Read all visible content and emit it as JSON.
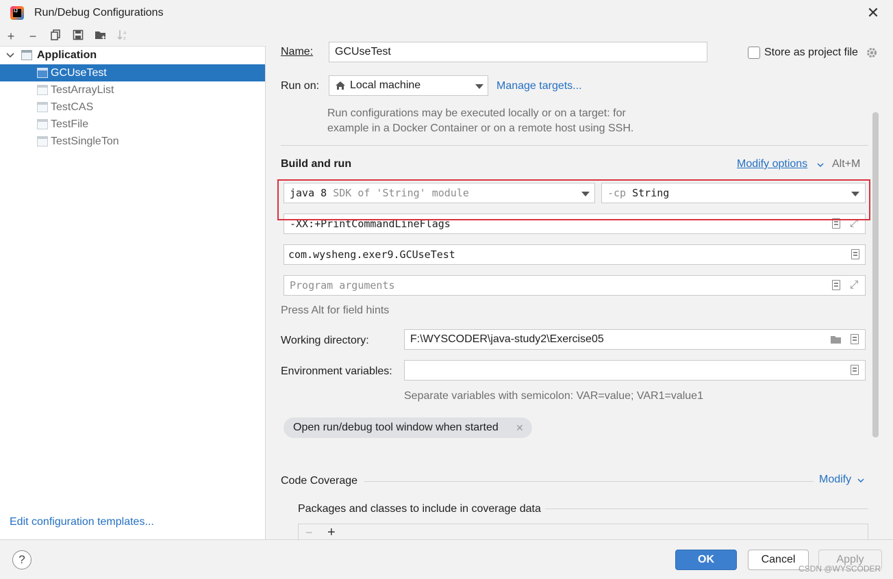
{
  "window": {
    "title": "Run/Debug Configurations",
    "close": "✕"
  },
  "left": {
    "toolbar": {
      "add": "+",
      "remove": "−"
    },
    "tree": {
      "group_label": "Application",
      "items": [
        "GCUseTest",
        "TestArrayList",
        "TestCAS",
        "TestFile",
        "TestSingleTon"
      ]
    },
    "edit_templates": "Edit configuration templates..."
  },
  "form": {
    "name_label": "Name:",
    "name_value": "GCUseTest",
    "store_label": "Store as project file",
    "run_on_label": "Run on:",
    "run_on_value": "Local machine",
    "manage_targets": "Manage targets...",
    "run_on_hint_1": "Run configurations may be executed locally or on a target: for",
    "run_on_hint_2": "example in a Docker Container or on a remote host using SSH.",
    "build_and_run": "Build and run",
    "modify_options": "Modify options",
    "modify_shortcut": "Alt+M",
    "sdk_main": "java 8",
    "sdk_sub": "SDK of 'String' module",
    "cp_flag": "-cp",
    "cp_value": "String",
    "vm_options": "-XX:+PrintCommandLineFlags",
    "main_class": "com.wysheng.exer9.GCUseTest",
    "program_args_placeholder": "Program arguments",
    "field_hint": "Press Alt for field hints",
    "working_dir_label": "Working directory:",
    "working_dir_value": "F:\\WYSCODER\\java-study2\\Exercise05",
    "env_label": "Environment variables:",
    "env_value": "",
    "env_hint": "Separate variables with semicolon: VAR=value; VAR1=value1",
    "chip_label": "Open run/debug tool window when started",
    "code_coverage": "Code Coverage",
    "modify": "Modify",
    "packages_label": "Packages and classes to include in coverage data",
    "cov_remove": "−",
    "cov_add": "+"
  },
  "buttons": {
    "help": "?",
    "ok": "OK",
    "cancel": "Cancel",
    "apply": "Apply"
  },
  "watermark": "CSDN @WYSCODER",
  "colors": {
    "accent": "#2675bf",
    "link": "#2470c2",
    "highlight": "#d9333f"
  }
}
